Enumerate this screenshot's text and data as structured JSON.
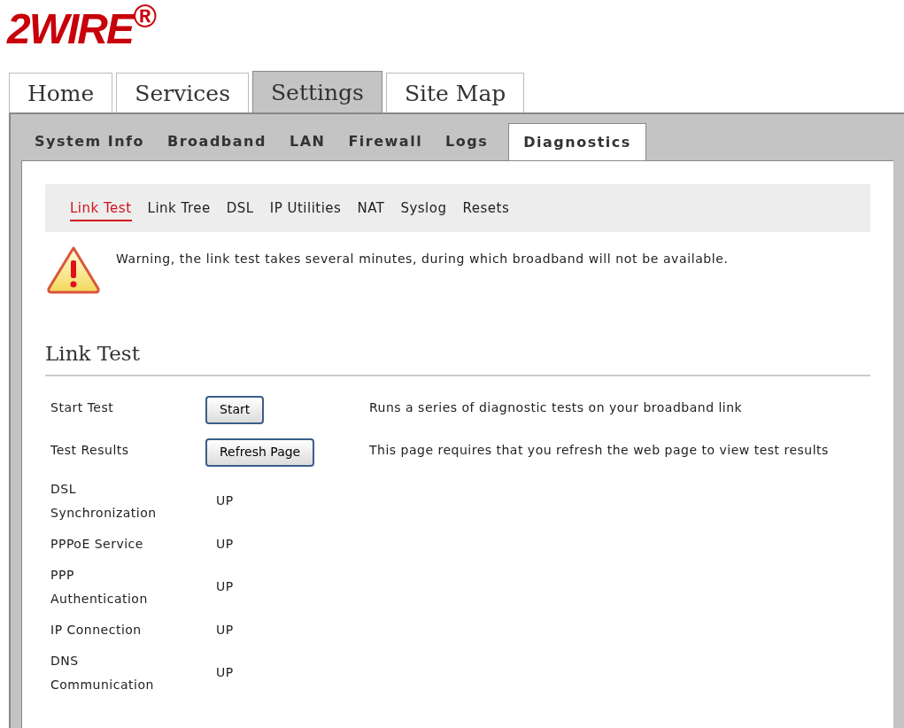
{
  "logo": {
    "text": "2WIRE$^{®}$"
  },
  "main_tabs": [
    {
      "label": "Home",
      "selected": false
    },
    {
      "label": "Services",
      "selected": false
    },
    {
      "label": "Settings",
      "selected": true
    },
    {
      "label": "Site Map",
      "selected": false
    }
  ],
  "section_tabs": [
    {
      "label": "System Info",
      "selected": false
    },
    {
      "label": "Broadband",
      "selected": false
    },
    {
      "label": "LAN",
      "selected": false
    },
    {
      "label": "Firewall",
      "selected": false
    },
    {
      "label": "Logs",
      "selected": false
    },
    {
      "label": "Diagnostics",
      "selected": true
    }
  ],
  "sub_tabs": [
    {
      "label": "Link Test",
      "selected": true
    },
    {
      "label": "Link Tree",
      "selected": false
    },
    {
      "label": "DSL",
      "selected": false
    },
    {
      "label": "IP Utilities",
      "selected": false
    },
    {
      "label": "NAT",
      "selected": false
    },
    {
      "label": "Syslog",
      "selected": false
    },
    {
      "label": "Resets",
      "selected": false
    }
  ],
  "warning": {
    "text": "Warning, the link test takes several minutes, during which broadband will not be available."
  },
  "heading": "Link Test",
  "rows": [
    {
      "kind": "button",
      "label": "Start Test",
      "button": "Start",
      "description": "Runs a series of diagnostic tests on your broadband link"
    },
    {
      "kind": "button",
      "label": "Test Results",
      "button": "Refresh Page",
      "description": "This page requires that you refresh the web page to view test results"
    },
    {
      "kind": "status",
      "label": "DSL Synchronization",
      "value": "UP"
    },
    {
      "kind": "status",
      "label": "PPPoE Service",
      "value": "UP"
    },
    {
      "kind": "status",
      "label": "PPP Authentication",
      "value": "UP"
    },
    {
      "kind": "status",
      "label": "IP Connection",
      "value": "UP"
    },
    {
      "kind": "status",
      "label": "DNS Communication",
      "value": "UP"
    }
  ]
}
